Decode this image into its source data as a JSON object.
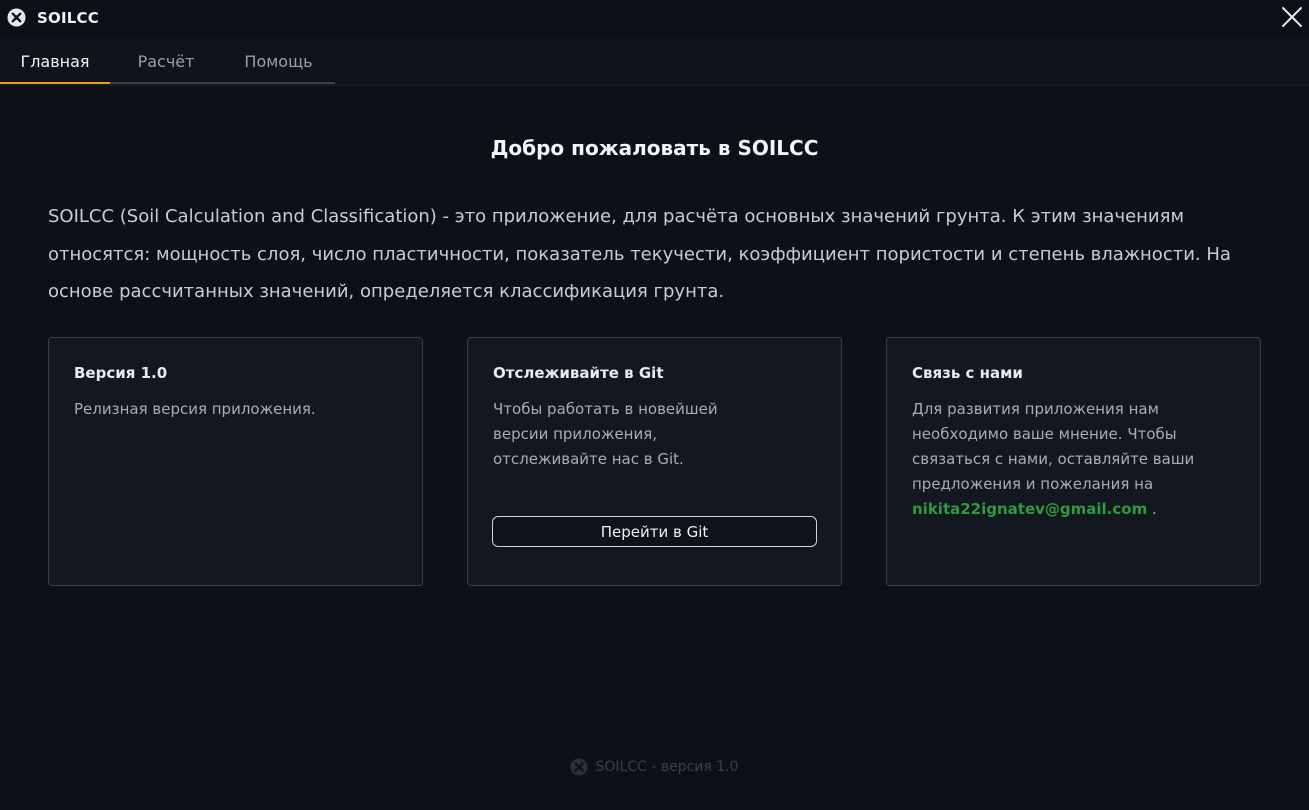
{
  "window": {
    "title": "SOILCC",
    "close_icon": "close-icon"
  },
  "tabs": [
    {
      "label": "Главная",
      "active": true
    },
    {
      "label": "Расчёт",
      "active": false
    },
    {
      "label": "Помощь",
      "active": false
    }
  ],
  "main": {
    "heading": "Добро пожаловать в SOILCC",
    "intro": "SOILCC (Soil Calculation and Classification) - это приложение, для расчёта основных значений грунта. К этим значениям относятся: мощность слоя, число пластичности, показатель текучести, коэффициент пористости и степень влажности. На основе рассчитанных значений, определяется классификация грунта."
  },
  "cards": {
    "version": {
      "title": "Версия 1.0",
      "text": "Релизная версия приложения."
    },
    "git": {
      "title": "Отслеживайте в Git",
      "text": "Чтобы работать в новейшей версии приложения, отслеживайте нас в Git.",
      "button_label": "Перейти в Git"
    },
    "contact": {
      "title": "Связь с нами",
      "text_before": "Для развития приложения нам необходимо ваше мнение. Чтобы связаться с нами, оставляйте ваши предложения и пожелания на ",
      "email": "nikita22ignatev@gmail.com",
      "text_after": " ."
    }
  },
  "footer": {
    "text": "SOILCC - версия 1.0"
  },
  "colors": {
    "accent": "#e8a126",
    "email": "#2f9a3e",
    "background": "#0d1017"
  }
}
